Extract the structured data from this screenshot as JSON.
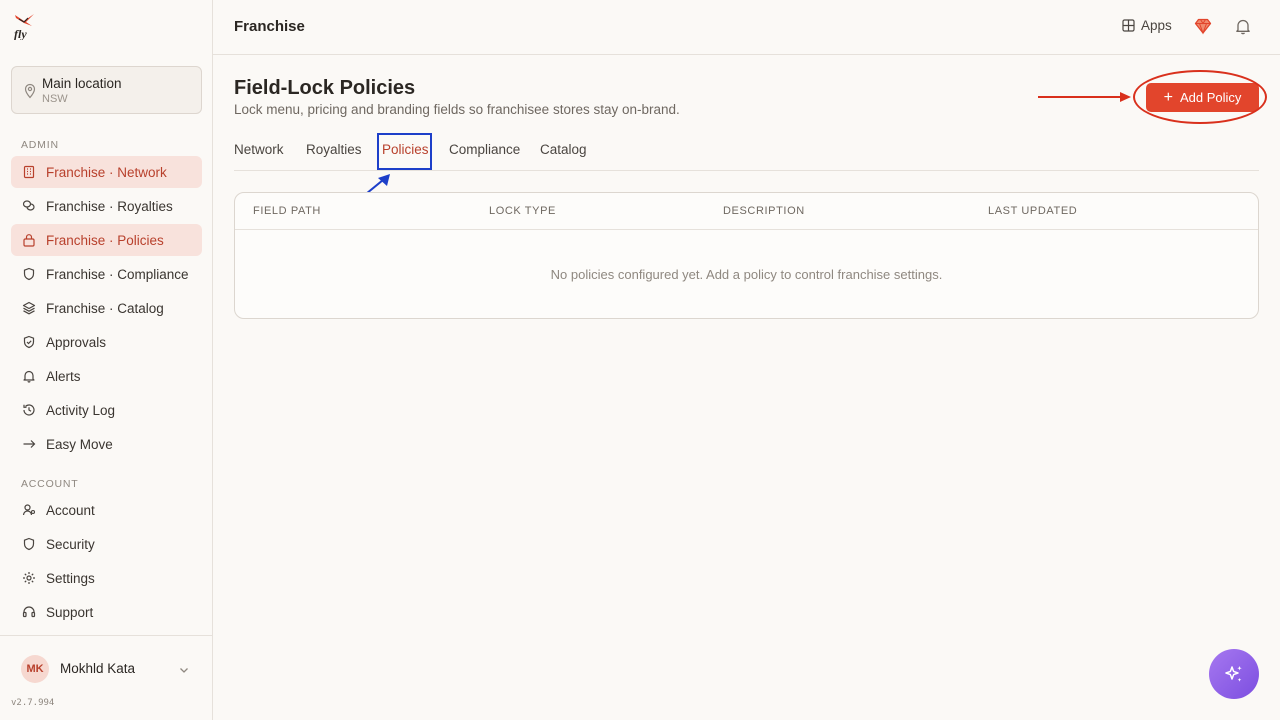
{
  "app": {
    "version": "v2.7.994"
  },
  "location": {
    "name": "Main location",
    "region": "NSW"
  },
  "sidebar": {
    "admin_label": "ADMIN",
    "account_label": "ACCOUNT",
    "admin_items": [
      {
        "label": "Franchise · Network",
        "icon": "building-icon"
      },
      {
        "label": "Franchise · Royalties",
        "icon": "coins-icon"
      },
      {
        "label": "Franchise · Policies",
        "icon": "lock-icon"
      },
      {
        "label": "Franchise · Compliance",
        "icon": "shield-icon"
      },
      {
        "label": "Franchise · Catalog",
        "icon": "layers-icon"
      },
      {
        "label": "Approvals",
        "icon": "shield-check-icon"
      },
      {
        "label": "Alerts",
        "icon": "bell-icon"
      },
      {
        "label": "Activity Log",
        "icon": "history-icon"
      },
      {
        "label": "Easy Move",
        "icon": "arrow-right-icon"
      }
    ],
    "account_items": [
      {
        "label": "Account",
        "icon": "user-icon"
      },
      {
        "label": "Security",
        "icon": "shield-icon"
      },
      {
        "label": "Settings",
        "icon": "gear-icon"
      },
      {
        "label": "Support",
        "icon": "headset-icon"
      }
    ]
  },
  "user": {
    "initials": "MK",
    "name": "Mokhld Kata"
  },
  "header": {
    "title": "Franchise",
    "apps_label": "Apps"
  },
  "page": {
    "title": "Field-Lock Policies",
    "subtitle": "Lock menu, pricing and branding fields so franchisee stores stay on-brand.",
    "add_button": "Add Policy"
  },
  "tabs": [
    {
      "label": "Network"
    },
    {
      "label": "Royalties"
    },
    {
      "label": "Policies"
    },
    {
      "label": "Compliance"
    },
    {
      "label": "Catalog"
    }
  ],
  "table": {
    "columns": [
      "FIELD PATH",
      "LOCK TYPE",
      "DESCRIPTION",
      "LAST UPDATED"
    ],
    "empty_message": "No policies configured yet. Add a policy to control franchise settings."
  },
  "colors": {
    "accent": "#e2452c",
    "active_text": "#b8402c",
    "active_bg": "#f8e2dc",
    "annotation_red": "#d9301c",
    "annotation_blue": "#1d3fc9"
  }
}
